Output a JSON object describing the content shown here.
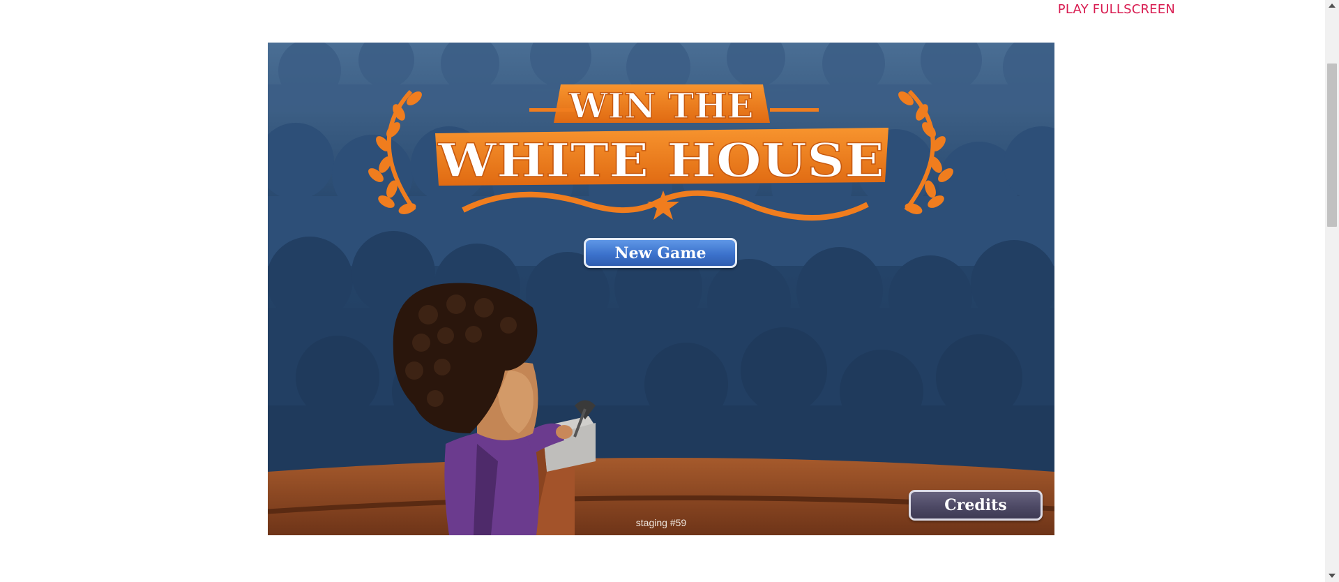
{
  "header": {
    "fullscreen_label": "PLAY FULLSCREEN"
  },
  "game": {
    "logo_text_line1": "WIN THE",
    "logo_text_line2": "WHITE HOUSE",
    "new_game_label": "New Game",
    "credits_label": "Credits",
    "build_label": "staging #59"
  },
  "colors": {
    "accent_link": "#d81b50",
    "logo_orange": "#f07d1e",
    "new_game_button": "#3c72cc",
    "credits_button": "#4d4965",
    "background_crowd": "#1e3a5c"
  },
  "scrollbar": {
    "up_icon": "triangle-up",
    "down_icon": "triangle-down"
  }
}
